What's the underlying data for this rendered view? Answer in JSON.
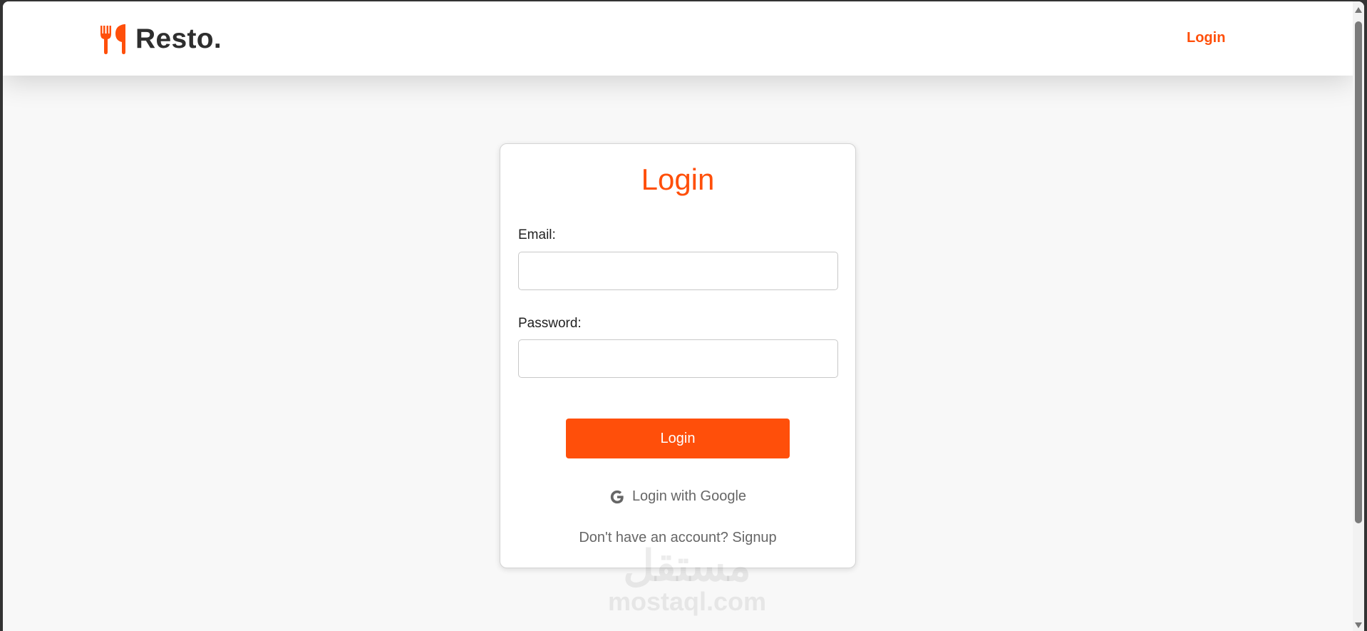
{
  "navbar": {
    "brand_text": "Resto.",
    "brand_icon": "fork-knife-icon",
    "login_link": "Login"
  },
  "login_card": {
    "title": "Login",
    "email_label": "Email:",
    "email_value": "",
    "password_label": "Password:",
    "password_value": "",
    "submit_label": "Login",
    "google_label": "Login with Google",
    "google_icon": "google-icon",
    "signup_prompt": "Don't have an account?",
    "signup_link": "Signup"
  },
  "watermark": {
    "arabic": "مستقل",
    "latin": "mostaql.com"
  },
  "colors": {
    "accent": "#ff4f0a",
    "page_background": "#f8f8f8",
    "card_background": "#ffffff",
    "text_dark": "#2e2e2e",
    "text_muted": "#666666"
  }
}
